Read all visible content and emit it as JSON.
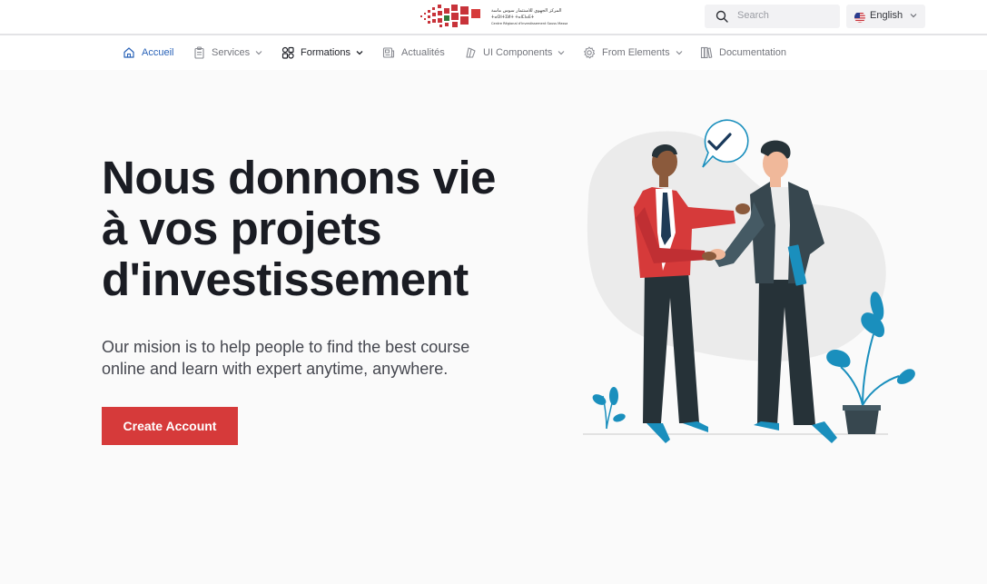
{
  "header": {
    "logo_text": "المركز الجهوي للاستثمار سوس ماسة Centre Régional d'Investissement Souss Massa",
    "search": {
      "placeholder": "Search",
      "icon": "search-icon"
    },
    "language": {
      "label": "English",
      "flag": "us-flag-icon"
    }
  },
  "nav": {
    "items": [
      {
        "label": "Accueil",
        "icon": "home-icon",
        "state": "active"
      },
      {
        "label": "Services",
        "icon": "clipboard-icon",
        "dropdown": true
      },
      {
        "label": "Formations",
        "icon": "grid-icon",
        "dropdown": true
      },
      {
        "label": "Actualités",
        "icon": "newspaper-icon"
      },
      {
        "label": "UI Components",
        "icon": "layers-icon",
        "dropdown": true
      },
      {
        "label": "From Elements",
        "icon": "gear-icon",
        "dropdown": true
      },
      {
        "label": "Documentation",
        "icon": "books-icon"
      }
    ]
  },
  "hero": {
    "title_line1": "Nous donnons vie",
    "title_line2": "à vos projets",
    "title_line3": "d'investissement",
    "subtitle_line1": "Our mision is to help people to find the best course",
    "subtitle_line2": "online and learn with expert anytime, anywhere.",
    "cta_label": "Create Account"
  },
  "colors": {
    "accent_red": "#d63a3a",
    "nav_active": "#2a63b8",
    "title": "#1a1c23",
    "text_muted": "#45474f",
    "illustration_blue": "#1a8fbd"
  }
}
